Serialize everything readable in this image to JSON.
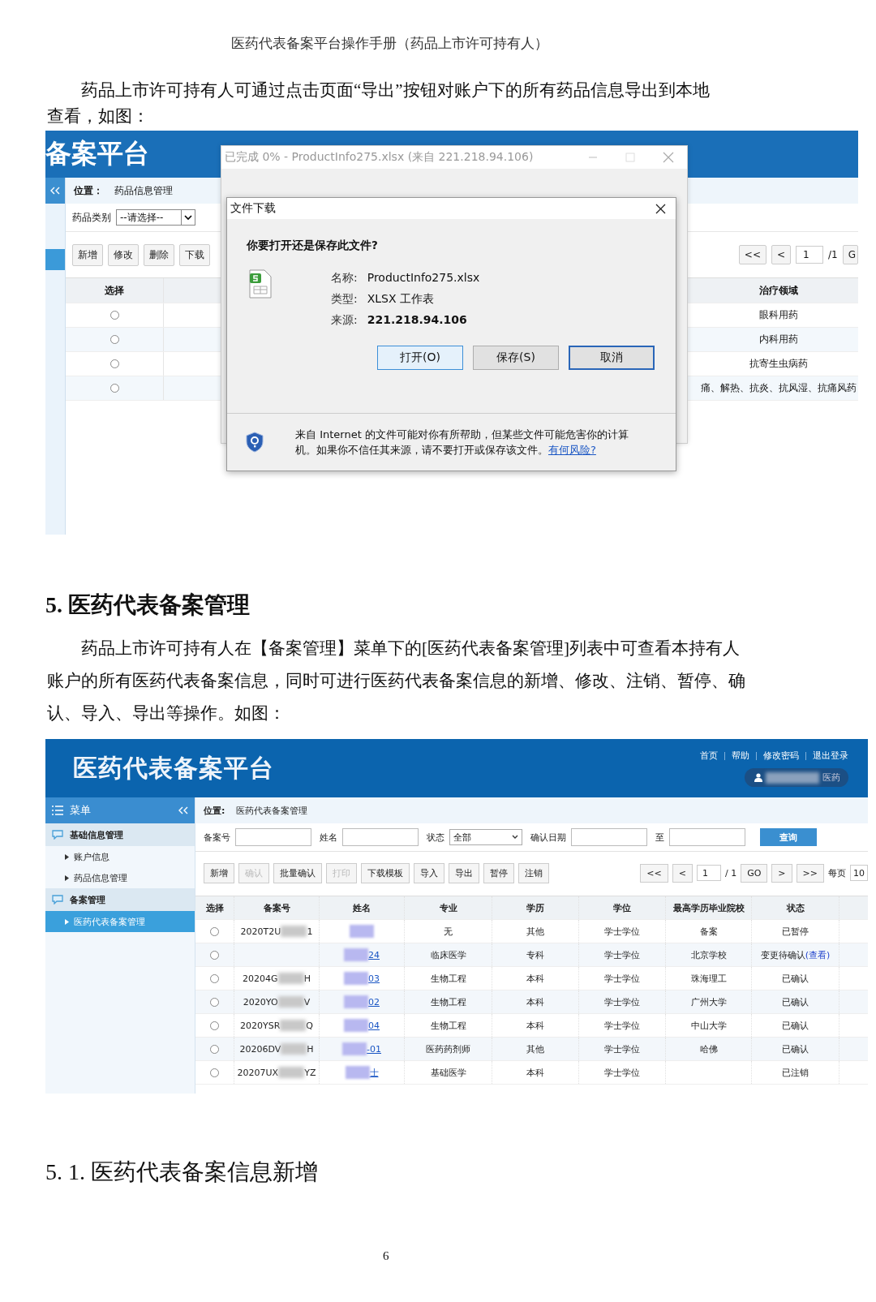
{
  "doc_header": "医药代表备案平台操作手册（药品上市许可持有人）",
  "paragraph_1": "药品上市许可持有人可通过点击页面“导出”按钮对账户下的所有药品信息导出到本地查看，如图：",
  "screenshot_1": {
    "app_title": "备案平台",
    "location_label": "位置：",
    "location": "药品信息管理",
    "filter_label": "药品类别",
    "filter_value": "--请选择--",
    "buttons": [
      "新增",
      "修改",
      "删除",
      "下载"
    ],
    "pager": {
      "first": "<<",
      "prev": "<",
      "page": "1",
      "total": "/1",
      "go": "G"
    },
    "columns": [
      "选择",
      "治疗领域"
    ],
    "rows": [
      {
        "selected": false,
        "area": "眼科用药"
      },
      {
        "selected": false,
        "area": "内科用药"
      },
      {
        "selected": false,
        "area": "抗寄生虫病药"
      },
      {
        "selected": false,
        "area": "痛、解热、抗炎、抗风湿、抗痛风药"
      }
    ],
    "download_window": {
      "title": "已完成 0% - ProductInfo275.xlsx (来自 221.218.94.106)"
    },
    "dialog": {
      "title": "文件下载",
      "question": "你要打开还是保存此文件?",
      "fields": [
        {
          "label": "名称:",
          "value": "ProductInfo275.xlsx",
          "bold": false
        },
        {
          "label": "类型:",
          "value": "XLSX 工作表",
          "bold": false
        },
        {
          "label": "来源:",
          "value": "221.218.94.106",
          "bold": true
        }
      ],
      "buttons": [
        {
          "label": "打开(O)",
          "kind": "default"
        },
        {
          "label": "保存(S)",
          "kind": "normal"
        },
        {
          "label": "取消",
          "kind": "focused"
        }
      ],
      "warning": "来自 Internet 的文件可能对你有所帮助，但某些文件可能危害你的计算机。如果你不信任其来源，请不要打开或保存该文件。",
      "warning_link": "有何风险?"
    }
  },
  "section_heading": "5. 医药代表备案管理",
  "paragraph_2": "药品上市许可持有人在【备案管理】菜单下的[医药代表备案管理]列表中可查看本持有人账户的所有医药代表备案信息，同时可进行医药代表备案信息的新增、修改、注销、暂停、确认、导入、导出等操作。如图：",
  "screenshot_2": {
    "app_title": "医药代表备案平台",
    "top_links": [
      "首页",
      "帮助",
      "修改密码",
      "退出登录"
    ],
    "user_suffix": "医药",
    "menu_title": "菜单",
    "menu": [
      {
        "label": "基础信息管理",
        "children": [
          {
            "label": "账户信息",
            "selected": false
          },
          {
            "label": "药品信息管理",
            "selected": false
          }
        ]
      },
      {
        "label": "备案管理",
        "children": [
          {
            "label": "医药代表备案管理",
            "selected": true
          }
        ]
      }
    ],
    "location_label": "位置:",
    "location": "医药代表备案管理",
    "filters": [
      {
        "label": "备案号",
        "kind": "text"
      },
      {
        "label": "姓名",
        "kind": "text"
      },
      {
        "label": "状态",
        "kind": "select",
        "value": "全部"
      },
      {
        "label": "确认日期",
        "kind": "text"
      },
      {
        "label": "至",
        "kind": "text"
      }
    ],
    "search_button": "查询",
    "actions": [
      {
        "label": "新增",
        "disabled": false
      },
      {
        "label": "确认",
        "disabled": true
      },
      {
        "label": "批量确认",
        "disabled": false
      },
      {
        "label": "打印",
        "disabled": true
      },
      {
        "label": "下载模板",
        "disabled": false
      },
      {
        "label": "导入",
        "disabled": false
      },
      {
        "label": "导出",
        "disabled": false
      },
      {
        "label": "暂停",
        "disabled": false
      },
      {
        "label": "注销",
        "disabled": false
      }
    ],
    "pager": {
      "first": "<<",
      "prev": "<",
      "page": "1",
      "total": "/ 1",
      "go": "GO",
      "next": ">",
      "last": ">>",
      "per_page_label": "每页",
      "per_page": "10"
    },
    "columns": [
      "选择",
      "备案号",
      "姓名",
      "专业",
      "学历",
      "学位",
      "最高学历毕业院校",
      "状态"
    ],
    "rows": [
      {
        "selected": false,
        "id_start": "2020T2U",
        "id_end": "1",
        "major": "无",
        "education": "其他",
        "degree": "学士学位",
        "school": "备案",
        "status": "已暂停"
      },
      {
        "selected": false,
        "name_end": "24",
        "major": "临床医学",
        "education": "专科",
        "degree": "学士学位",
        "school": "北京学校",
        "status": "变更待确认",
        "status_link": "(查看)"
      },
      {
        "selected": false,
        "id_start": "20204G",
        "id_end": "H",
        "name_end": "03",
        "major": "生物工程",
        "education": "本科",
        "degree": "学士学位",
        "school": "珠海理工",
        "status": "已确认"
      },
      {
        "selected": false,
        "id_start": "2020YO",
        "id_end": "V",
        "name_end": "02",
        "major": "生物工程",
        "education": "本科",
        "degree": "学士学位",
        "school": "广州大学",
        "status": "已确认"
      },
      {
        "selected": false,
        "id_start": "2020YSR",
        "id_end": "Q",
        "name_end": "04",
        "major": "生物工程",
        "education": "本科",
        "degree": "学士学位",
        "school": "中山大学",
        "status": "已确认"
      },
      {
        "selected": false,
        "id_start": "20206DV",
        "id_end": "H",
        "name_end": "-01",
        "major": "医药药剂师",
        "education": "其他",
        "degree": "学士学位",
        "school": "哈佛",
        "status": "已确认"
      },
      {
        "selected": false,
        "id_start": "20207UX",
        "id_end": "YZ",
        "name_end": "士",
        "major": "基础医学",
        "education": "本科",
        "degree": "学士学位",
        "status": "已注销"
      }
    ]
  },
  "subsection_heading": "5. 1. 医药代表备案信息新增",
  "page_number": "6"
}
